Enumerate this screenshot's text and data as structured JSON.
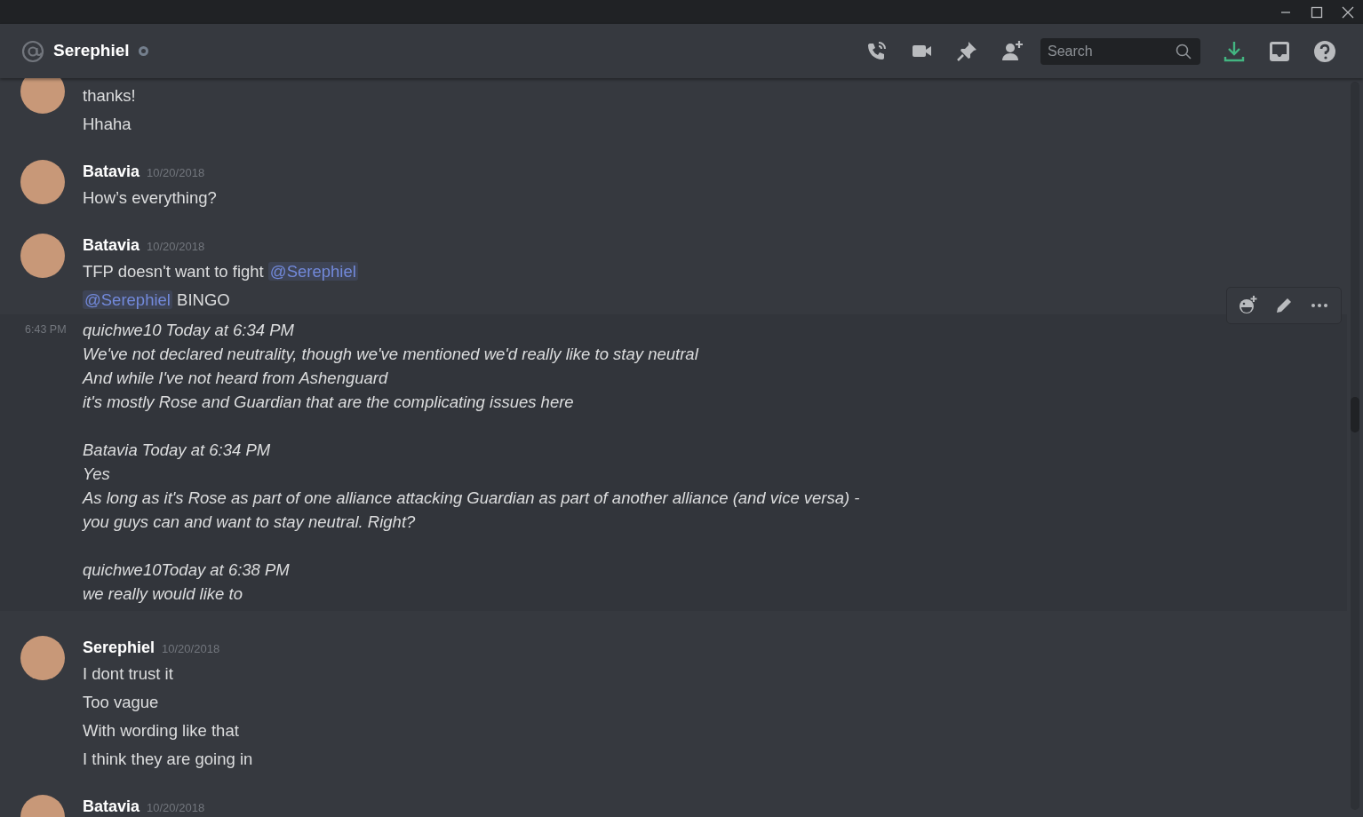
{
  "header": {
    "title": "Serephiel",
    "search": {
      "placeholder": "Search"
    }
  },
  "groups": [
    {
      "kind": "continued",
      "hovered": false,
      "messages": [
        {
          "kind": "plain",
          "segments": [
            {
              "kind": "text",
              "text": "thanks!"
            }
          ]
        },
        {
          "kind": "plain",
          "segments": [
            {
              "kind": "text",
              "text": "Hhaha"
            }
          ]
        }
      ]
    },
    {
      "kind": "full",
      "author": "Batavia",
      "timestamp": "10/20/2018",
      "hovered": false,
      "messages": [
        {
          "kind": "plain",
          "segments": [
            {
              "kind": "text",
              "text": "How’s everything?"
            }
          ]
        }
      ]
    },
    {
      "kind": "full",
      "author": "Batavia",
      "timestamp": "10/20/2018",
      "hovered": false,
      "messages": [
        {
          "kind": "plain",
          "segments": [
            {
              "kind": "text",
              "text": "TFP doesn't want to fight "
            },
            {
              "kind": "mention",
              "text": "@Serephiel"
            }
          ]
        },
        {
          "kind": "plain",
          "segments": [
            {
              "kind": "mention",
              "text": "@Serephiel"
            },
            {
              "kind": "text",
              "text": " BINGO"
            }
          ]
        }
      ]
    },
    {
      "kind": "compact",
      "timestamp": "6:43 PM",
      "hovered": true,
      "messages": [
        {
          "kind": "italic",
          "segments": [
            {
              "kind": "text",
              "text": "quichwe10 Today at 6:34 PM"
            }
          ]
        },
        {
          "kind": "italic",
          "segments": [
            {
              "kind": "text",
              "text": "We've not declared neutrality, though we've mentioned we'd really like to stay neutral"
            }
          ]
        },
        {
          "kind": "italic",
          "segments": [
            {
              "kind": "text",
              "text": "And while I've not heard from Ashenguard"
            }
          ]
        },
        {
          "kind": "italic",
          "segments": [
            {
              "kind": "text",
              "text": "it's mostly Rose and Guardian that are the complicating issues here"
            }
          ]
        },
        {
          "kind": "gap"
        },
        {
          "kind": "italic",
          "segments": [
            {
              "kind": "text",
              "text": "Batavia Today at 6:34 PM"
            }
          ]
        },
        {
          "kind": "italic",
          "segments": [
            {
              "kind": "text",
              "text": "Yes"
            }
          ]
        },
        {
          "kind": "italic",
          "segments": [
            {
              "kind": "text",
              "text": "As long as it's Rose as part of one alliance attacking Guardian as part of another alliance (and vice versa) -"
            }
          ]
        },
        {
          "kind": "italic",
          "segments": [
            {
              "kind": "text",
              "text": "you guys can and want to stay neutral. Right?"
            }
          ]
        },
        {
          "kind": "gap"
        },
        {
          "kind": "italic",
          "segments": [
            {
              "kind": "text",
              "text": "quichwe10Today at 6:38 PM"
            }
          ]
        },
        {
          "kind": "italic",
          "segments": [
            {
              "kind": "text",
              "text": "we really would like to"
            }
          ]
        }
      ]
    },
    {
      "kind": "full",
      "author": "Serephiel",
      "timestamp": "10/20/2018",
      "hovered": false,
      "messages": [
        {
          "kind": "plain",
          "segments": [
            {
              "kind": "text",
              "text": "I dont trust it"
            }
          ]
        },
        {
          "kind": "plain",
          "segments": [
            {
              "kind": "text",
              "text": "Too vague"
            }
          ]
        },
        {
          "kind": "plain",
          "segments": [
            {
              "kind": "text",
              "text": "With wording like that"
            }
          ]
        },
        {
          "kind": "plain",
          "segments": [
            {
              "kind": "text",
              "text": "I think they are going in"
            }
          ]
        }
      ]
    },
    {
      "kind": "full",
      "author": "Batavia",
      "timestamp": "10/20/2018",
      "hovered": false
    }
  ]
}
